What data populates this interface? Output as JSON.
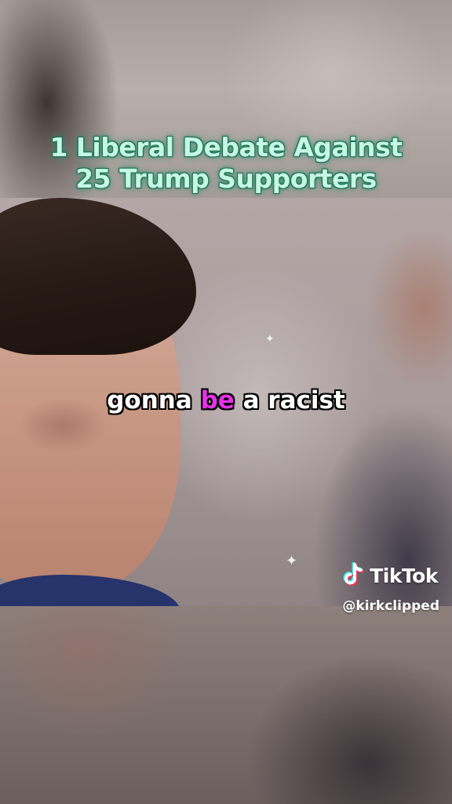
{
  "title": {
    "line1": "1 Liberal Debate Against",
    "line2": "25 Trump Supporters"
  },
  "caption": {
    "before": "gonna ",
    "highlight": "be",
    "after": " a racist"
  },
  "watermark": {
    "brand": "TikTok",
    "handle": "@kirkclipped",
    "icon": "tiktok-note-icon"
  },
  "colors": {
    "title_fill": "#c6f7e4",
    "title_glow": "#2fa07c",
    "caption_text": "#ffffff",
    "caption_highlight": "#e631e8",
    "tiktok_cyan": "#25f4ee",
    "tiktok_red": "#fe2c55"
  }
}
